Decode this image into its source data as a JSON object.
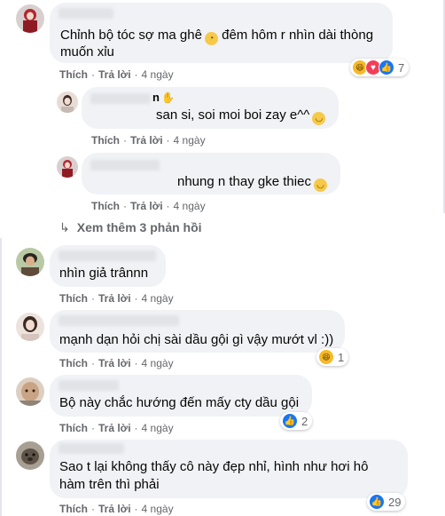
{
  "actions": {
    "like": "Thích",
    "reply": "Trả lời"
  },
  "comments": [
    {
      "text_line1": "Chỉnh bộ tóc sợ ma ghê",
      "text_line1b": "đêm hôm r nhìn dài thòng",
      "text_line2": "muốn xỉu",
      "time": "4 ngày",
      "reaction_count": "7",
      "emoji": "rolling-eyes-emoji"
    },
    {
      "name_fragment": "n",
      "text": "san si, soi moi boi zay e^^",
      "time": "4 ngày",
      "emoji": "smile-emoji"
    },
    {
      "text": "nhung n thay gke thiec",
      "time": "4 ngày",
      "emoji": "smile-emoji"
    },
    {
      "text": "nhìn giả trânnn",
      "time": "4 ngày"
    },
    {
      "text": "mạnh dạn hỏi chị sài dầu gội gì vậy mướt vl :))",
      "time": "4 ngày",
      "reaction_count": "1"
    },
    {
      "text": "Bộ này chắc hướng đến mấy cty dầu gội",
      "time": "4 ngày",
      "reaction_count": "2"
    },
    {
      "text_line1": "Sao t lại không thấy cô này đẹp nhỉ, hình như hơi hô",
      "text_line2": "hàm trên thì phải",
      "time": "4 ngày",
      "reaction_count": "29"
    }
  ],
  "view_more": "Xem thêm 3 phản hồi",
  "colors": {
    "bubble": "#f0f2f5",
    "meta": "#65676b",
    "like_blue": "#1877f2",
    "love_red": "#f33e58",
    "haha_yellow": "#f7b928"
  }
}
